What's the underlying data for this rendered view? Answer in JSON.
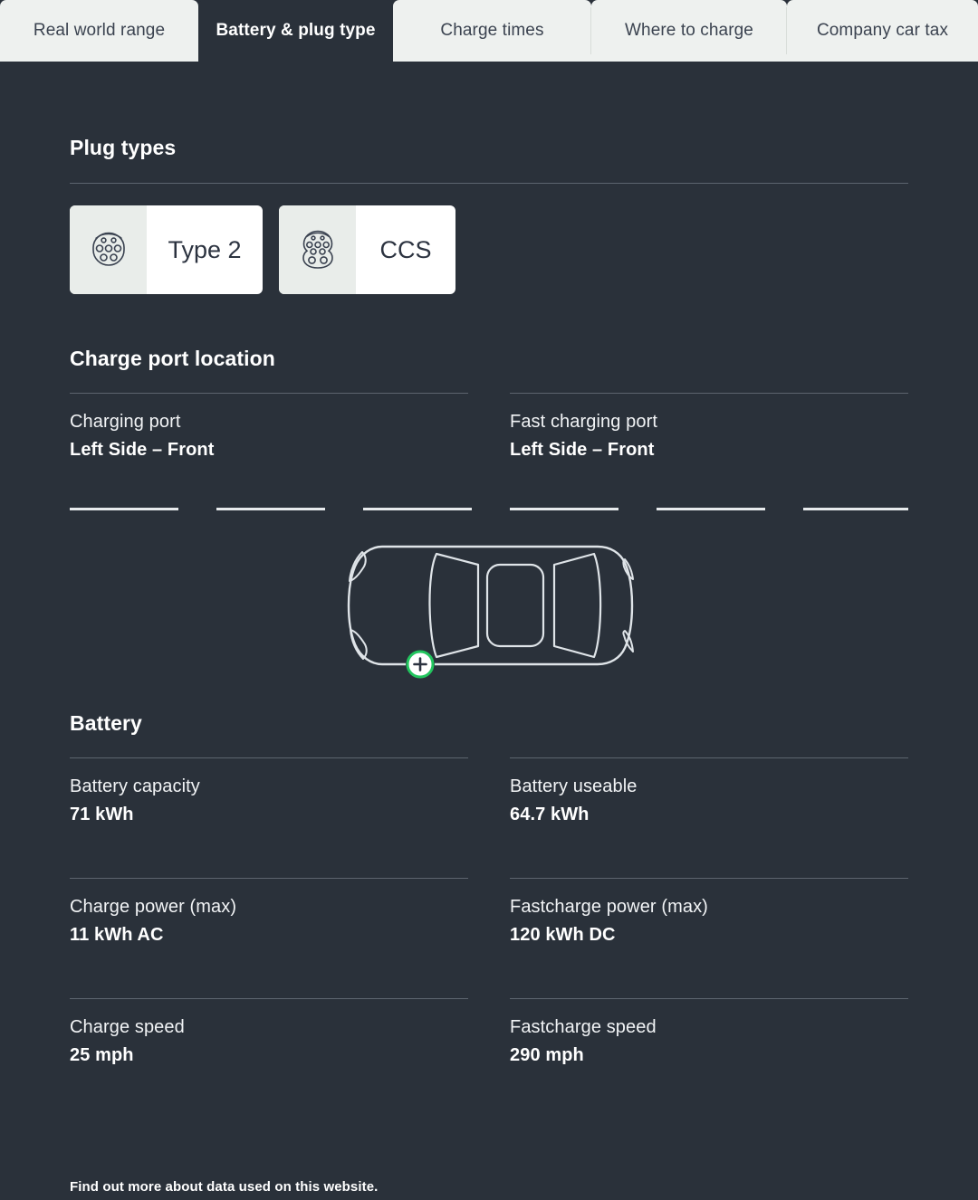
{
  "tabs": [
    {
      "label": "Real world range",
      "active": false
    },
    {
      "label": "Battery & plug type",
      "active": true
    },
    {
      "label": "Charge times",
      "active": false
    },
    {
      "label": "Where to charge",
      "active": false
    },
    {
      "label": "Company car tax",
      "active": false
    }
  ],
  "plug_types": {
    "title": "Plug types",
    "cards": [
      {
        "label": "Type 2",
        "icon": "type2-plug-icon"
      },
      {
        "label": "CCS",
        "icon": "ccs-plug-icon"
      }
    ]
  },
  "charge_port_location": {
    "title": "Charge port location",
    "fields": [
      {
        "label": "Charging port",
        "value": "Left Side – Front"
      },
      {
        "label": "Fast charging port",
        "value": "Left Side – Front"
      }
    ],
    "car_diagram": {
      "view": "top-down",
      "marker": "charge-port-marker",
      "marker_position": "front-left",
      "marker_glyph": "+"
    }
  },
  "battery": {
    "title": "Battery",
    "fields": [
      {
        "label": "Battery capacity",
        "value": "71 kWh"
      },
      {
        "label": "Battery useable",
        "value": "64.7 kWh"
      },
      {
        "label": "Charge power (max)",
        "value": "11 kWh AC"
      },
      {
        "label": "Fastcharge power (max)",
        "value": "120 kWh DC"
      },
      {
        "label": "Charge speed",
        "value": "25 mph"
      },
      {
        "label": "Fastcharge speed",
        "value": "290 mph"
      }
    ]
  },
  "footer": {
    "link_text": "Find out more about data used on this website."
  },
  "colors": {
    "page_background": "#2a313a",
    "tab_inactive_background": "#eef1ef",
    "tab_inactive_text": "#3b4350",
    "card_background": "#ffffff",
    "card_icon_pane": "#e9edea",
    "rule": "#5d656f",
    "accent_green": "#22c55e",
    "text_primary": "#ffffff"
  }
}
